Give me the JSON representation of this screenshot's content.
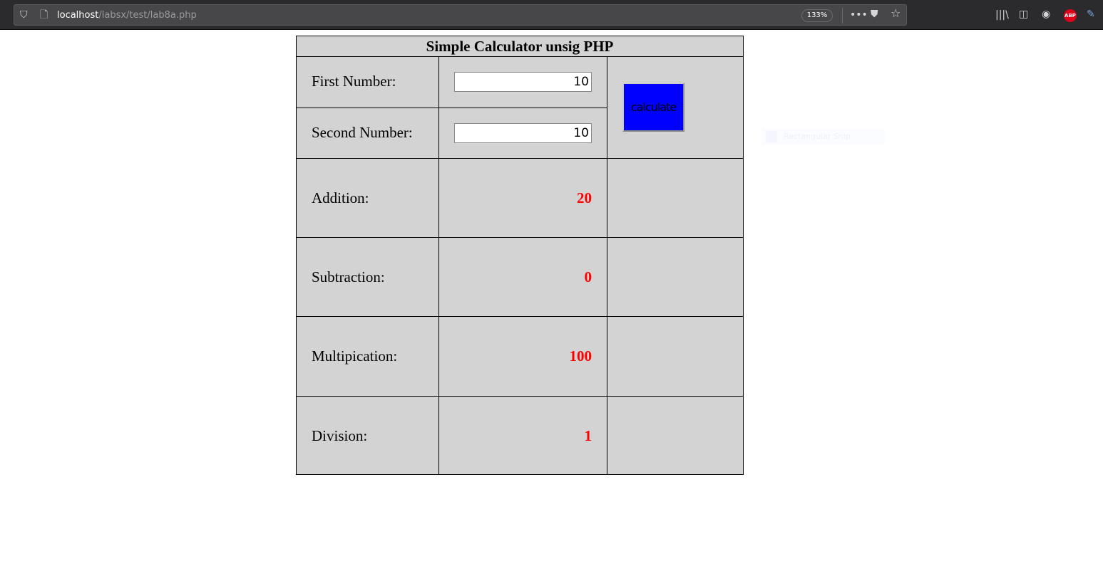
{
  "browser": {
    "url_host": "localhost",
    "url_path": "/labsx/test/lab8a.php",
    "zoom": "133%",
    "abp": "ABP"
  },
  "page": {
    "title": "Simple Calculator unsig PHP",
    "first_label": "First Number:",
    "first_value": "10",
    "second_label": "Second Number:",
    "second_value": "10",
    "calculate_label": "calculate",
    "results": [
      {
        "label": "Addition:",
        "value": "20"
      },
      {
        "label": "Subtraction:",
        "value": "0"
      },
      {
        "label": "Multipication:",
        "value": "100"
      },
      {
        "label": "Division:",
        "value": "1"
      }
    ]
  },
  "overlay": {
    "snip_label": "Rectangular Snip"
  }
}
